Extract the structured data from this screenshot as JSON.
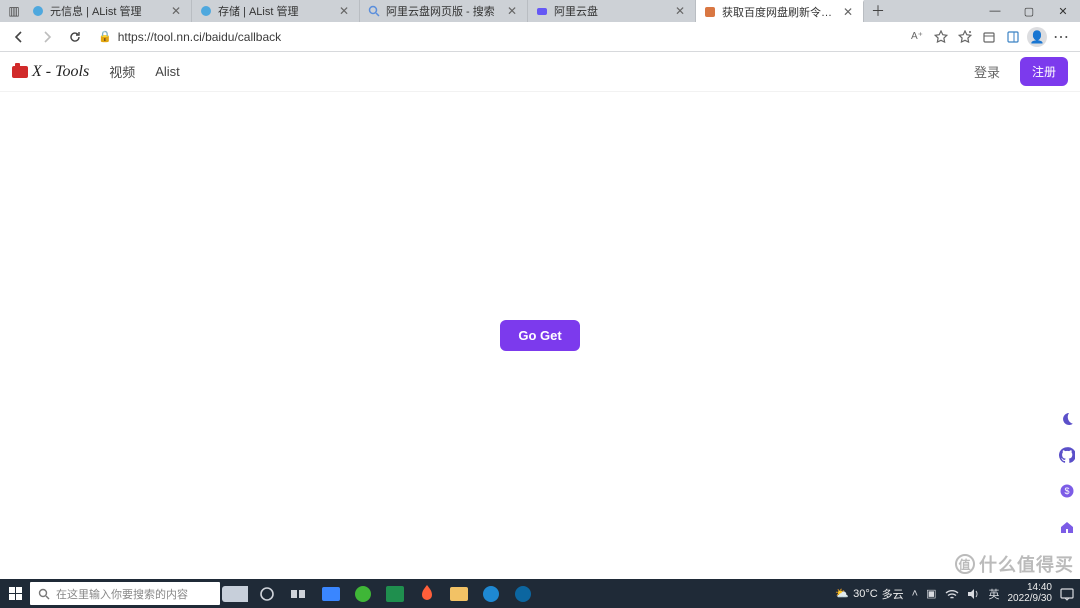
{
  "browser": {
    "tabs": [
      {
        "title": "元信息 | AList 管理",
        "active": false,
        "favicon": "alist"
      },
      {
        "title": "存储 | AList 管理",
        "active": false,
        "favicon": "alist"
      },
      {
        "title": "阿里云盘网页版 - 搜索",
        "active": false,
        "favicon": "search"
      },
      {
        "title": "阿里云盘",
        "active": false,
        "favicon": "aliyun"
      },
      {
        "title": "获取百度网盘刷新令牌回调 - XT",
        "active": true,
        "favicon": "xtools"
      }
    ],
    "url": "https://tool.nn.ci/baidu/callback"
  },
  "site": {
    "brand": "X - Tools",
    "nav": {
      "video": "视频",
      "alist": "Alist"
    },
    "login": "登录",
    "register": "注册",
    "go_get": "Go Get"
  },
  "float_rail": {
    "moon": "moon-icon",
    "github": "github-icon",
    "donate": "donate-icon",
    "home": "home-icon"
  },
  "watermark": {
    "badge": "值",
    "text": "什么值得买"
  },
  "taskbar": {
    "search_placeholder": "在这里输入你要搜索的内容",
    "weather": {
      "temp": "30°C",
      "desc": "多云"
    },
    "ime": "英",
    "time": "14:40",
    "date": "2022/9/30"
  }
}
